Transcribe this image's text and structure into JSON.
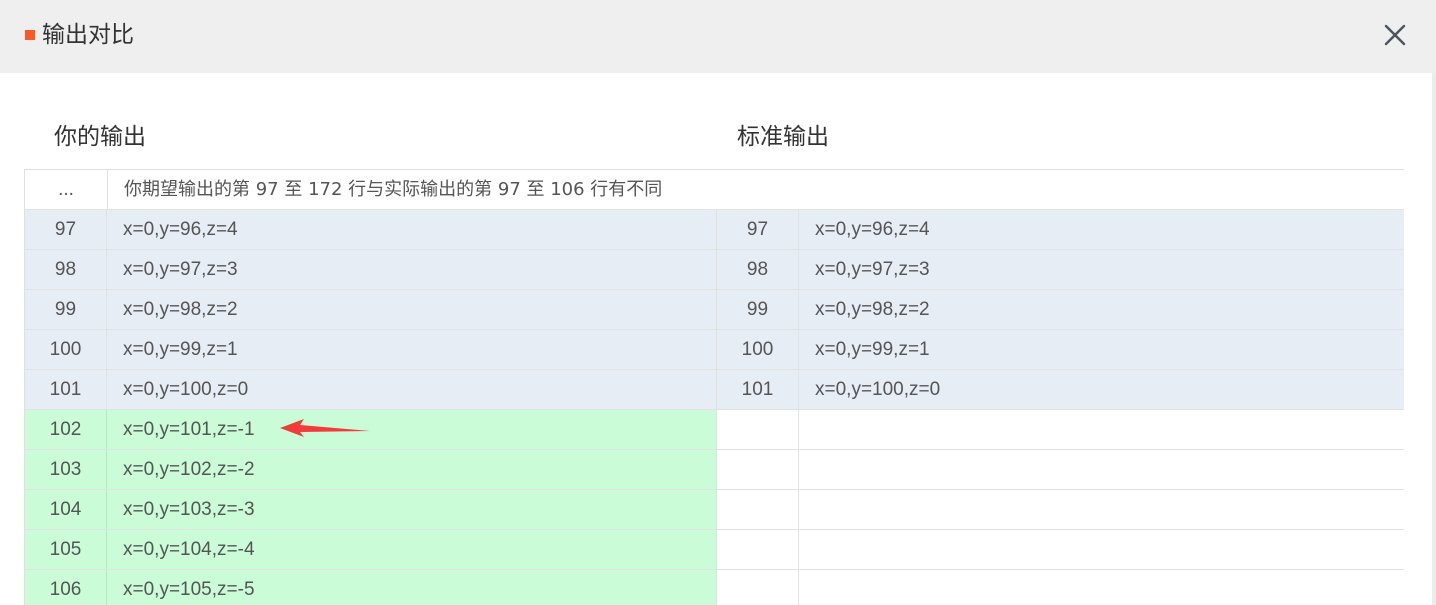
{
  "dialog": {
    "title": "输出对比",
    "close_icon": "close-icon",
    "accent_color": "#ff5722"
  },
  "columns": {
    "left_heading": "你的输出",
    "right_heading": "标准输出"
  },
  "summary": {
    "marker": "...",
    "message": "你期望输出的第 97 至 172 行与实际输出的第 97 至 106 行有不同"
  },
  "rows": [
    {
      "status": "same",
      "left_num": "97",
      "left_text": "x=0,y=96,z=4",
      "right_num": "97",
      "right_text": "x=0,y=96,z=4"
    },
    {
      "status": "same",
      "left_num": "98",
      "left_text": "x=0,y=97,z=3",
      "right_num": "98",
      "right_text": "x=0,y=97,z=3"
    },
    {
      "status": "same",
      "left_num": "99",
      "left_text": "x=0,y=98,z=2",
      "right_num": "99",
      "right_text": "x=0,y=98,z=2"
    },
    {
      "status": "same",
      "left_num": "100",
      "left_text": "x=0,y=99,z=1",
      "right_num": "100",
      "right_text": "x=0,y=99,z=1"
    },
    {
      "status": "same",
      "left_num": "101",
      "left_text": "x=0,y=100,z=0",
      "right_num": "101",
      "right_text": "x=0,y=100,z=0"
    },
    {
      "status": "added",
      "left_num": "102",
      "left_text": "x=0,y=101,z=-1",
      "right_num": "",
      "right_text": ""
    },
    {
      "status": "added",
      "left_num": "103",
      "left_text": "x=0,y=102,z=-2",
      "right_num": "",
      "right_text": ""
    },
    {
      "status": "added",
      "left_num": "104",
      "left_text": "x=0,y=103,z=-3",
      "right_num": "",
      "right_text": ""
    },
    {
      "status": "added",
      "left_num": "105",
      "left_text": "x=0,y=104,z=-4",
      "right_num": "",
      "right_text": ""
    },
    {
      "status": "added",
      "left_num": "106",
      "left_text": "x=0,y=105,z=-5",
      "right_num": "",
      "right_text": ""
    }
  ],
  "colors": {
    "same_row_bg": "#e6edf5",
    "added_row_bg": "#c9fcd7",
    "annotation_arrow": "#f23b3b"
  },
  "annotation": {
    "icon": "red-arrow-icon",
    "points_to_row": "102"
  }
}
